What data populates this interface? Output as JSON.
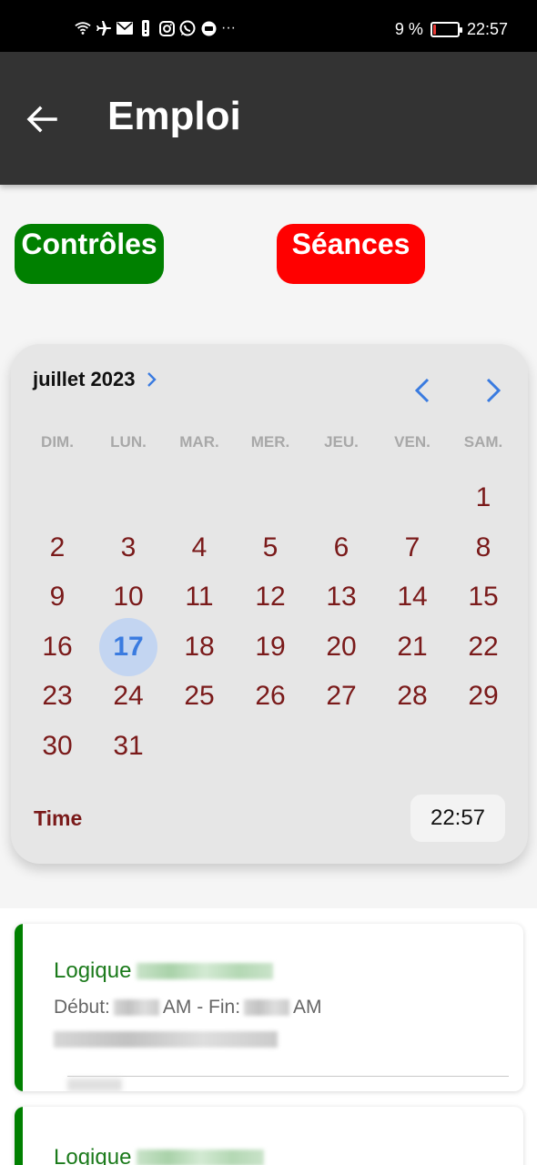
{
  "status_bar": {
    "icons": [
      "wifi-icon",
      "airplane-icon",
      "mail-icon",
      "alert-icon",
      "instagram-icon",
      "whatsapp-icon",
      "app-icon",
      "more-icon"
    ],
    "more": "···",
    "battery_text": "9 %",
    "battery_level": 0.09,
    "time": "22:57",
    "battery_color": "#e53935"
  },
  "app_bar": {
    "title": "Emploi",
    "background": "#333333"
  },
  "toggles": {
    "controles_label": "Contrôles",
    "controles_color": "#008000",
    "seances_label": "Séances",
    "seances_color": "#ff0000"
  },
  "calendar": {
    "month_label": "juillet 2023",
    "weekdays": [
      "DIM.",
      "LUN.",
      "MAR.",
      "MER.",
      "JEU.",
      "VEN.",
      "SAM."
    ],
    "leading_blank_days": 6,
    "days": [
      "1",
      "2",
      "3",
      "4",
      "5",
      "6",
      "7",
      "8",
      "9",
      "10",
      "11",
      "12",
      "13",
      "14",
      "15",
      "16",
      "17",
      "18",
      "19",
      "20",
      "21",
      "22",
      "23",
      "24",
      "25",
      "26",
      "27",
      "28",
      "29",
      "30",
      "31"
    ],
    "selected_day": "17",
    "time_label": "Time",
    "time_value": "22:57",
    "accent_color": "#3a7be0",
    "day_color": "#7a1a1a"
  },
  "sessions": [
    {
      "title": "Logique",
      "debut_label": "Début:",
      "am1": "AM - Fin:",
      "am2": "AM"
    },
    {
      "title": "Logique"
    }
  ]
}
